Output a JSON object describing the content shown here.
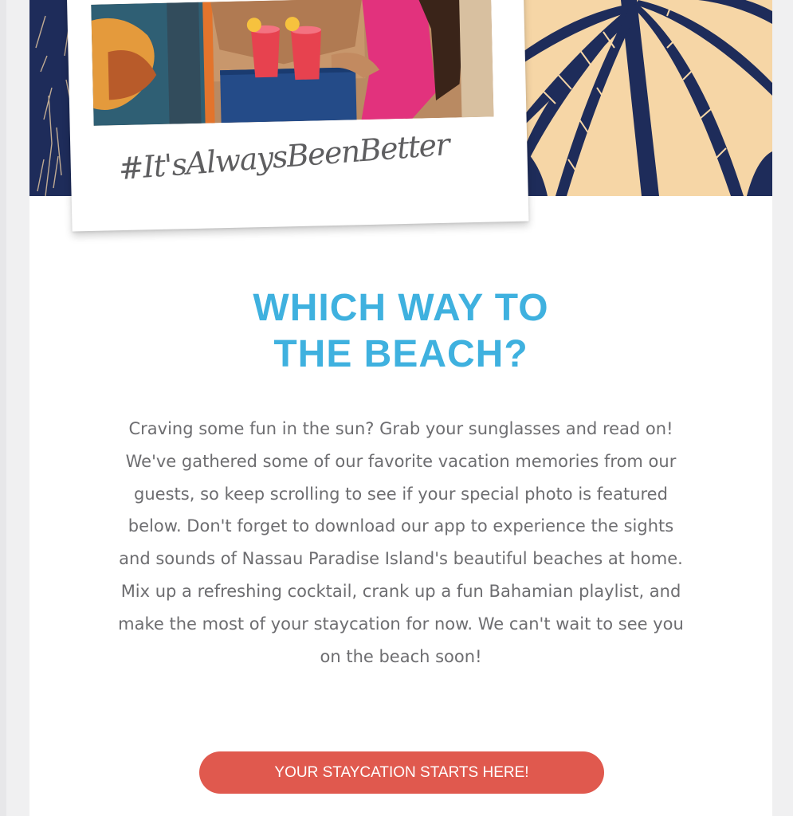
{
  "hero": {
    "hashtag": "#It'sAlwaysBeenBetter",
    "palm_color": "#1e2c5a",
    "sand_color": "#f6d6a6"
  },
  "content": {
    "headline_line1": "WHICH WAY TO",
    "headline_line2": "THE BEACH?",
    "body": "Craving some fun in the sun? Grab your sunglasses and read on! We've gathered some of our favorite vacation memories from our guests, so keep scrolling to see if your special photo is featured below. Don't forget to download our app to experience the sights and sounds of Nassau Paradise Island's beautiful beaches at home. Mix up a refreshing cocktail, crank up a fun Bahamian playlist, and make the most of your staycation for now. We can't wait to see you on the beach soon!",
    "headline_color": "#3fb1df",
    "body_color": "#6d6d70"
  },
  "cta": {
    "label": "YOUR STAYCATION STARTS HERE!",
    "color": "#e0594e"
  }
}
